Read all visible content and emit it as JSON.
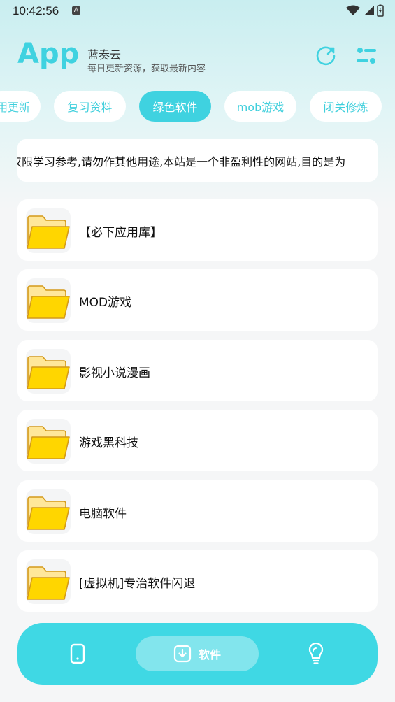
{
  "status_bar": {
    "time": "10:42:56",
    "notif_glyph": "A"
  },
  "header": {
    "logo": "App",
    "site_name": "蓝奏云",
    "subtitle": "每日更新资源，获取最新内容"
  },
  "tabs": [
    {
      "label": "用更新",
      "active": false
    },
    {
      "label": "复习资料",
      "active": false
    },
    {
      "label": "绿色软件",
      "active": true
    },
    {
      "label": "mob游戏",
      "active": false
    },
    {
      "label": "闭关修炼",
      "active": false
    }
  ],
  "notice": {
    "text": "仅限学习参考,请勿作其他用途,本站是一个非盈利性的网站,目的是为"
  },
  "folders": [
    {
      "label": "【必下应用库】",
      "icon": "folder-icon"
    },
    {
      "label": "MOD游戏",
      "icon": "folder-icon"
    },
    {
      "label": "影视小说漫画",
      "icon": "folder-icon"
    },
    {
      "label": "游戏黑科技",
      "icon": "folder-icon"
    },
    {
      "label": "电脑软件",
      "icon": "folder-icon"
    },
    {
      "label": "[虚拟机]专治软件闪退",
      "icon": "folder-icon"
    }
  ],
  "bottom_nav": {
    "software_label": "软件"
  },
  "colors": {
    "accent": "#3fd2e0",
    "folder_yellow": "#ffd600",
    "folder_back": "#ffe79a",
    "folder_stroke": "#d49a1a"
  }
}
